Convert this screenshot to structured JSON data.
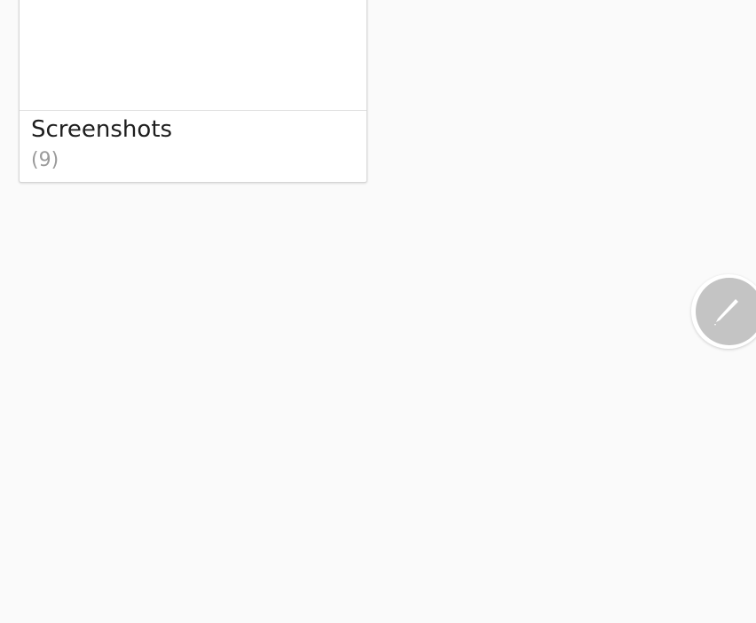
{
  "album": {
    "name": "Screenshots",
    "count": "(9)"
  },
  "fab": {
    "icon": "pen-icon",
    "color": "#c4c4c4"
  },
  "colors": {
    "background": "#fafafa",
    "card": "#ffffff"
  }
}
